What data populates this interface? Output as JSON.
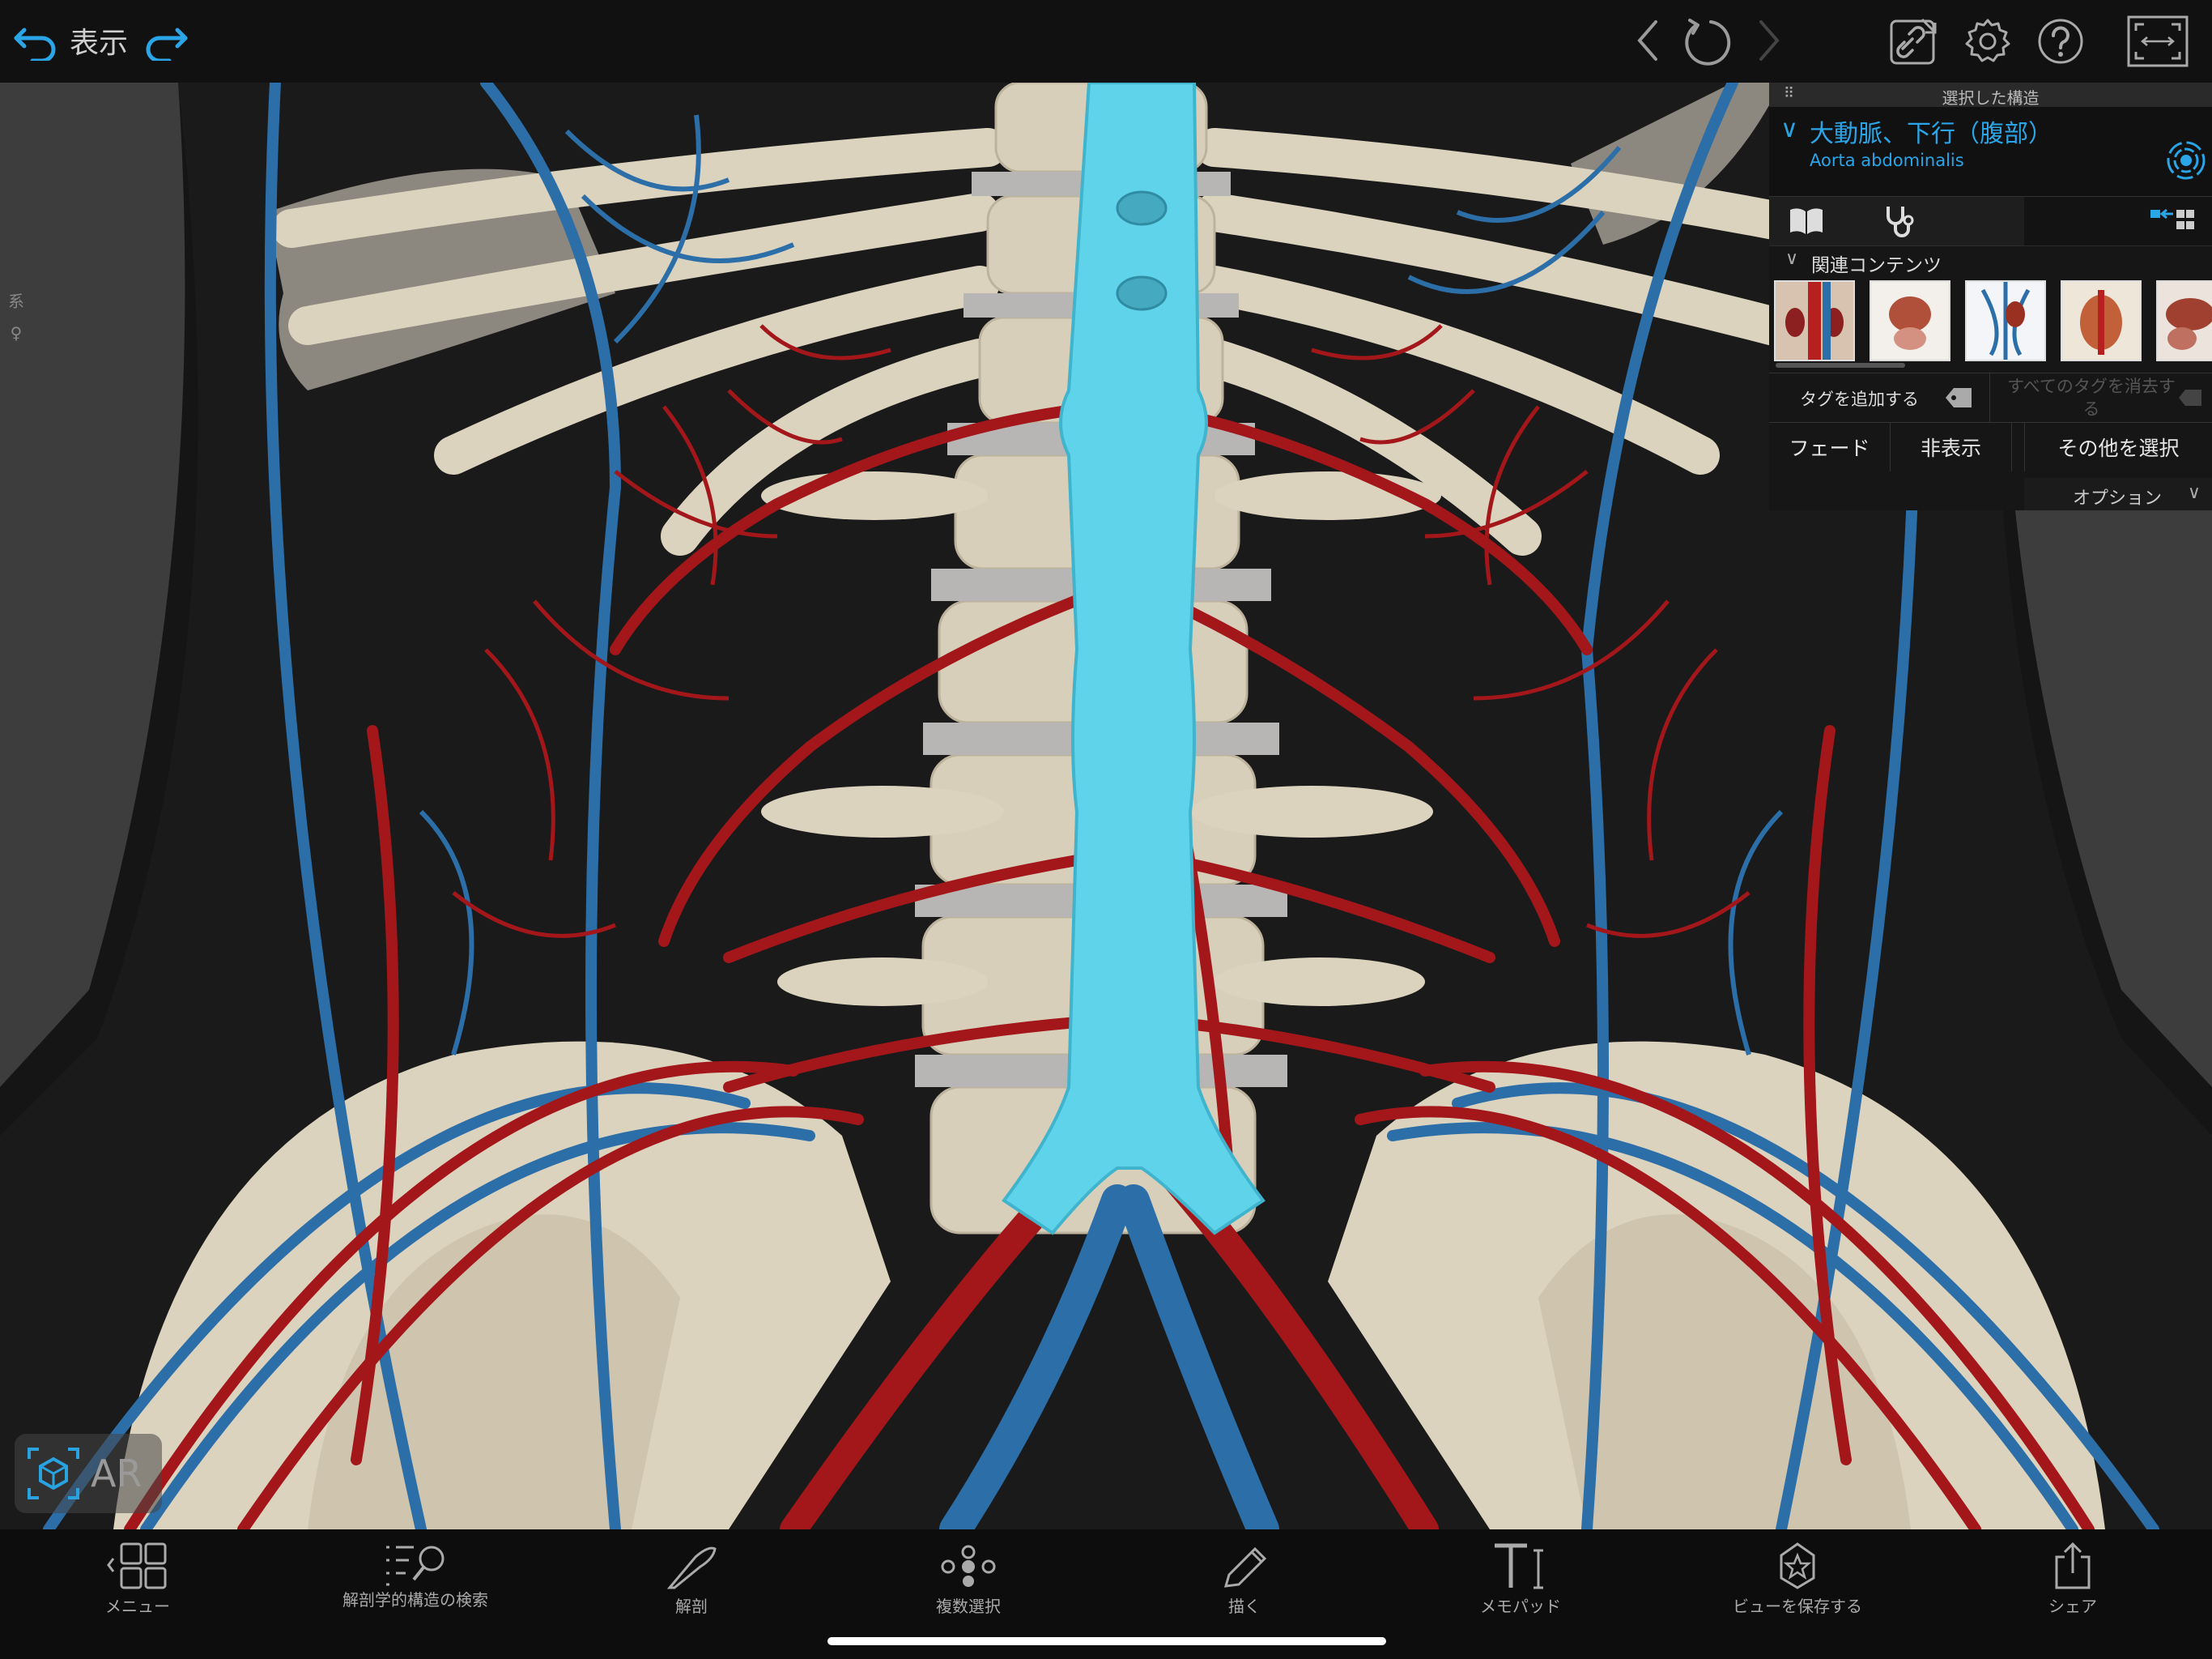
{
  "topbar": {
    "back_label": "表示"
  },
  "viewport": {
    "side_labels": [
      "系",
      "♀"
    ],
    "ar_label": "AR"
  },
  "panel": {
    "header_title": "選択した構造",
    "structure_name": "大動脈、下行（腹部）",
    "structure_latin": "Aorta abdominalis",
    "related_header": "関連コンテンツ",
    "add_tag_label": "タグを追加する",
    "clear_tags_label": "すべてのタグを消去する",
    "fade_label": "フェード",
    "hide_label": "非表示",
    "select_others_label": "その他を選択",
    "options_label": "オプション"
  },
  "bottombar": {
    "items": [
      {
        "label": "メニュー",
        "icon": "menu-grid-icon"
      },
      {
        "label": "解剖学的構造の検索",
        "icon": "search-list-icon"
      },
      {
        "label": "解剖",
        "icon": "scalpel-icon"
      },
      {
        "label": "複数選択",
        "icon": "multi-select-icon"
      },
      {
        "label": "描く",
        "icon": "pencil-icon"
      },
      {
        "label": "メモパッド",
        "icon": "text-icon"
      },
      {
        "label": "ビューを保存する",
        "icon": "star-icon"
      },
      {
        "label": "シェア",
        "icon": "share-icon"
      }
    ]
  },
  "colors": {
    "accent": "#2aa5e8",
    "artery": "#a3171b",
    "vein": "#2a6da5",
    "selected_structure": "#5ed3ea",
    "bone": "#ddd5c2"
  }
}
